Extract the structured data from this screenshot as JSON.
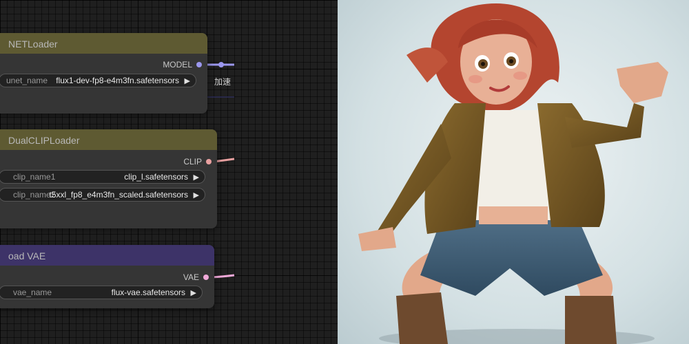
{
  "nodes": {
    "unet_loader": {
      "title": "NETLoader",
      "output": "MODEL",
      "widget_label": "unet_name",
      "widget_value": "flux1-dev-fp8-e4m3fn.safetensors"
    },
    "dual_clip_loader": {
      "title": "DualCLIPLoader",
      "output": "CLIP",
      "widgets": [
        {
          "label": "clip_name1",
          "value": "clip_l.safetensors"
        },
        {
          "label": "clip_name2",
          "value": "t5xxl_fp8_e4m3fn_scaled.safetensors"
        }
      ]
    },
    "vae_loader": {
      "title": "oad VAE",
      "output": "VAE",
      "widget_label": "vae_name",
      "widget_value": "flux-vae.safetensors"
    }
  },
  "edge_label": "加速",
  "colors": {
    "model_link": "#9b97ee",
    "clip_link": "#e8a0a0",
    "vae_link": "#f0a8d8",
    "olive_header": "#5e5a32",
    "purple_header": "#3d3368",
    "node_body": "#353535"
  },
  "icons": {
    "dropdown": "triangle-right"
  }
}
